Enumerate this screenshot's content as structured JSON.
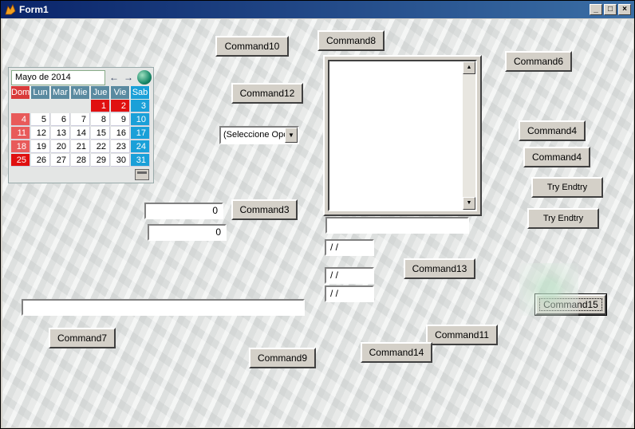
{
  "window": {
    "title": "Form1",
    "controls": {
      "minimize": "_",
      "maximize": "□",
      "close": "×"
    }
  },
  "buttons": {
    "command10": "Command10",
    "command8": "Command8",
    "command6": "Command6",
    "command12": "Command12",
    "command4a": "Command4",
    "command4b": "Command4",
    "try_endtry_1": "Try Endtry",
    "try_endtry_2": "Try Endtry",
    "command3": "Command3",
    "command13": "Command13",
    "command15": "Command15",
    "command7": "Command7",
    "command11": "Command11",
    "command14": "Command14",
    "command9": "Command9"
  },
  "combo": {
    "value": "(Seleccione Opc"
  },
  "numeric_fields": {
    "field1": "0",
    "field2": "0"
  },
  "date_fields": {
    "date1": " / /",
    "date2": " / /",
    "date3": " / /"
  },
  "text_fields": {
    "listbox_text": "",
    "wide_text": ""
  },
  "calendar": {
    "month_label": "Mayo de 2014",
    "day_names": [
      "Dom",
      "Lun",
      "Mar",
      "Mie",
      "Jue",
      "Vie",
      "Sab"
    ],
    "weeks": [
      [
        "",
        "",
        "",
        "",
        "1",
        "2",
        "3"
      ],
      [
        "4",
        "5",
        "6",
        "7",
        "8",
        "9",
        "10"
      ],
      [
        "11",
        "12",
        "13",
        "14",
        "15",
        "16",
        "17"
      ],
      [
        "18",
        "19",
        "20",
        "21",
        "22",
        "23",
        "24"
      ],
      [
        "25",
        "26",
        "27",
        "28",
        "29",
        "30",
        "31"
      ]
    ],
    "highlighted_days": [
      "1",
      "2",
      "25"
    ],
    "colors": {
      "sunday": "#e85a5a",
      "saturday": "#1aa0d8",
      "highlight": "#e01010",
      "header": "#5a8aa0"
    }
  },
  "icons": {
    "app": "fox-icon",
    "prev": "arrow-left-icon",
    "next": "arrow-right-icon",
    "today": "globe-icon",
    "calendar_footer": "calendar-icon",
    "scroll_up": "scroll-up-arrow-icon",
    "scroll_down": "scroll-down-arrow-icon"
  }
}
